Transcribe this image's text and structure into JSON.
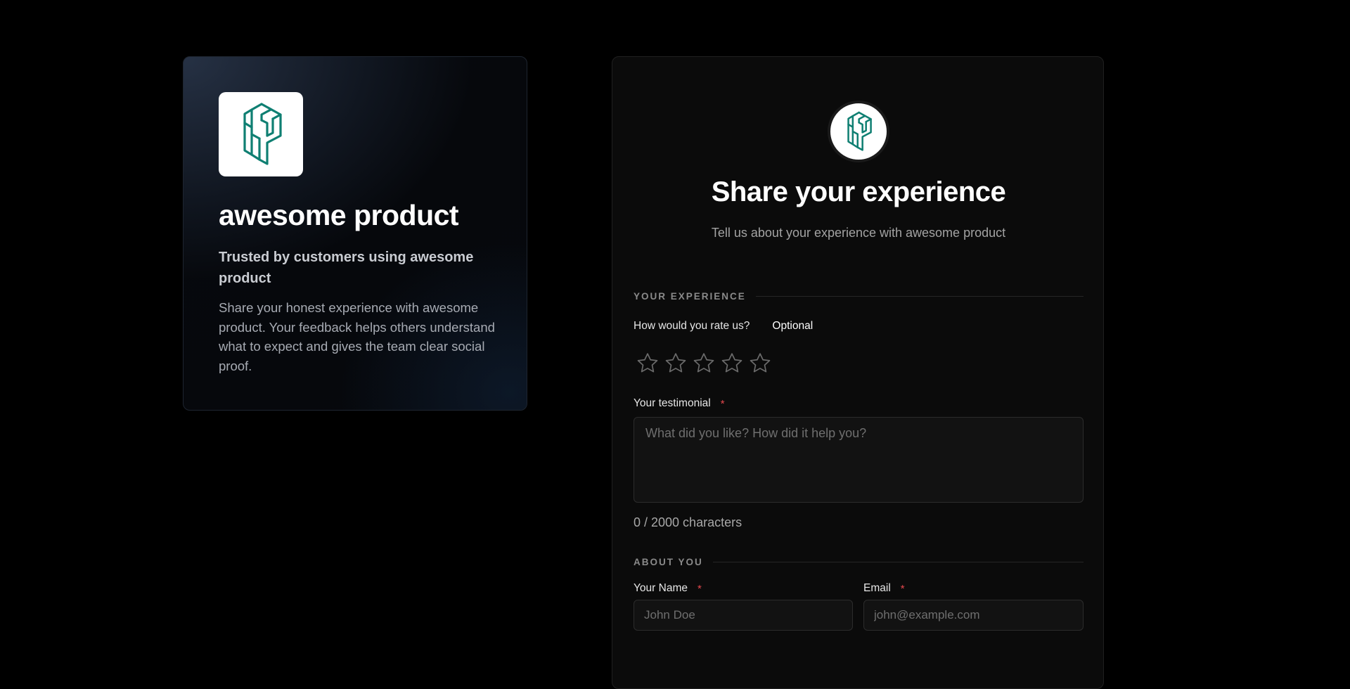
{
  "product": {
    "name": "awesome product",
    "tagline": "Trusted by customers using awesome product",
    "description": "Share your honest experience with awesome product. Your feedback helps others understand what to expect and gives the team clear social proof.",
    "logo_icon": "product-logo-icon"
  },
  "form": {
    "title": "Share your experience",
    "subtitle": "Tell us about your experience with awesome product",
    "sections": {
      "experience": "YOUR EXPERIENCE",
      "about": "ABOUT YOU"
    },
    "rating": {
      "label": "How would you rate us?",
      "optional": "Optional",
      "value": 0,
      "max": 5,
      "star_icon": "star-outline-icon"
    },
    "testimonial": {
      "label": "Your testimonial",
      "required_mark": "*",
      "placeholder": "What did you like? How did it help you?",
      "value": "",
      "char_count": "0 / 2000 characters"
    },
    "name": {
      "label": "Your Name",
      "required_mark": "*",
      "placeholder": "John Doe",
      "value": ""
    },
    "email": {
      "label": "Email",
      "required_mark": "*",
      "placeholder": "john@example.com",
      "value": ""
    }
  },
  "colors": {
    "background": "#000000",
    "brand_teal": "#0f7f72",
    "required": "#e5484d",
    "card": "#0b0b0b"
  }
}
